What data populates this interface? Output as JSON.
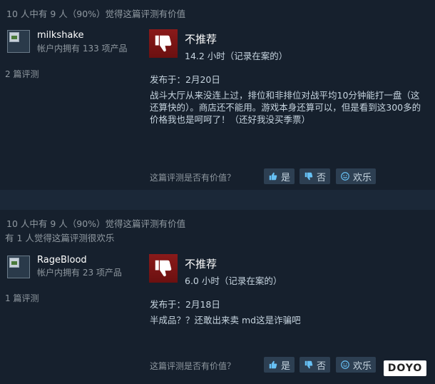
{
  "reviews": [
    {
      "helpful_summary": "10 人中有 9 人（90%）觉得这篇评测有价值",
      "funny_summary": "",
      "username": "milkshake",
      "products_owned": "帐户内拥有 133 项产品",
      "review_count": "2 篇评测",
      "verdict": "不推荐",
      "hours": "14.2 小时（记录在案的）",
      "posted": "发布于：2月20日",
      "text": "战斗大厅从来没连上过，排位和非排位对战平均10分钟能打一盘（这还算快的）。商店还不能用。游戏本身还算可以，但是看到这300多的价格我也是呵呵了！（还好我没买季票）"
    },
    {
      "helpful_summary": "10 人中有 9 人（90%）觉得这篇评测有价值",
      "funny_summary": "有 1 人觉得这篇评测很欢乐",
      "username": "RageBlood",
      "products_owned": "帐户内拥有 23 项产品",
      "review_count": "1 篇评测",
      "verdict": "不推荐",
      "hours": "6.0 小时（记录在案的）",
      "posted": "发布于：2月18日",
      "text": "半成品？？还敢出来卖 md这是诈骗吧"
    }
  ],
  "vote": {
    "question": "这篇评测是否有价值？",
    "yes": "是",
    "no": "否",
    "funny": "欢乐"
  },
  "watermark": "DOYO",
  "colors": {
    "background": "#1b2838",
    "panel": "#16202d",
    "thumb_down": "#8a1a1a",
    "button": "#2d3f52"
  }
}
